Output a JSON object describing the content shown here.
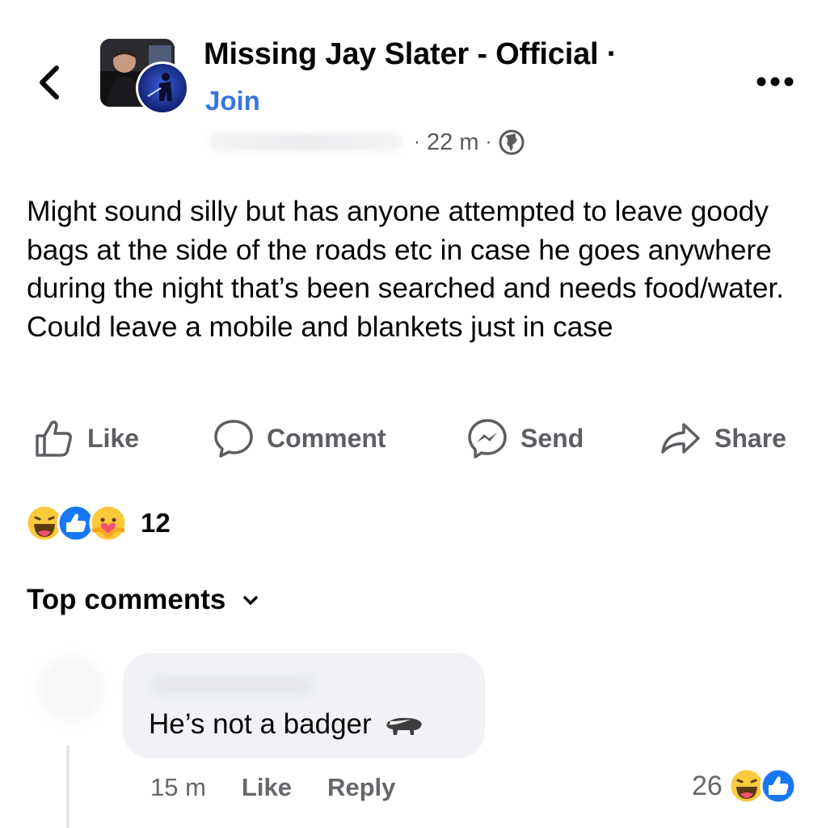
{
  "header": {
    "back_icon": "chevron-left-icon",
    "group_name": "Missing Jay Slater - Official ·",
    "join_label": "Join",
    "more_icon": "more-horizontal-icon"
  },
  "post": {
    "time": "22 m",
    "privacy_icon": "globe-icon",
    "text": "Might sound silly but has anyone attempted to leave goody bags at the side of the roads etc in case he goes anywhere during the night that’s been searched and needs food/water. Could leave a mobile and blankets just in case"
  },
  "actions": [
    {
      "label": "Like",
      "icon": "thumbs-up-icon"
    },
    {
      "label": "Comment",
      "icon": "comment-icon"
    },
    {
      "label": "Send",
      "icon": "messenger-icon"
    },
    {
      "label": "Share",
      "icon": "share-icon"
    }
  ],
  "reactions": {
    "icons": [
      "haha-icon",
      "like-reaction-icon",
      "care-icon"
    ],
    "count": "12"
  },
  "comments_section": {
    "sort_label": "Top comments",
    "sort_icon": "chevron-down-icon"
  },
  "comment": {
    "text": "He’s not a badger",
    "emoji_icon": "badger-emoji-icon",
    "time": "15 m",
    "like_label": "Like",
    "reply_label": "Reply",
    "reaction_count": "26",
    "reaction_icons": [
      "haha-icon",
      "like-reaction-icon"
    ]
  },
  "colors": {
    "join_blue": "#3b74e0",
    "like_blue": "#1877f2",
    "muted_text": "#65676b",
    "bubble_bg": "#f0f2f5"
  }
}
